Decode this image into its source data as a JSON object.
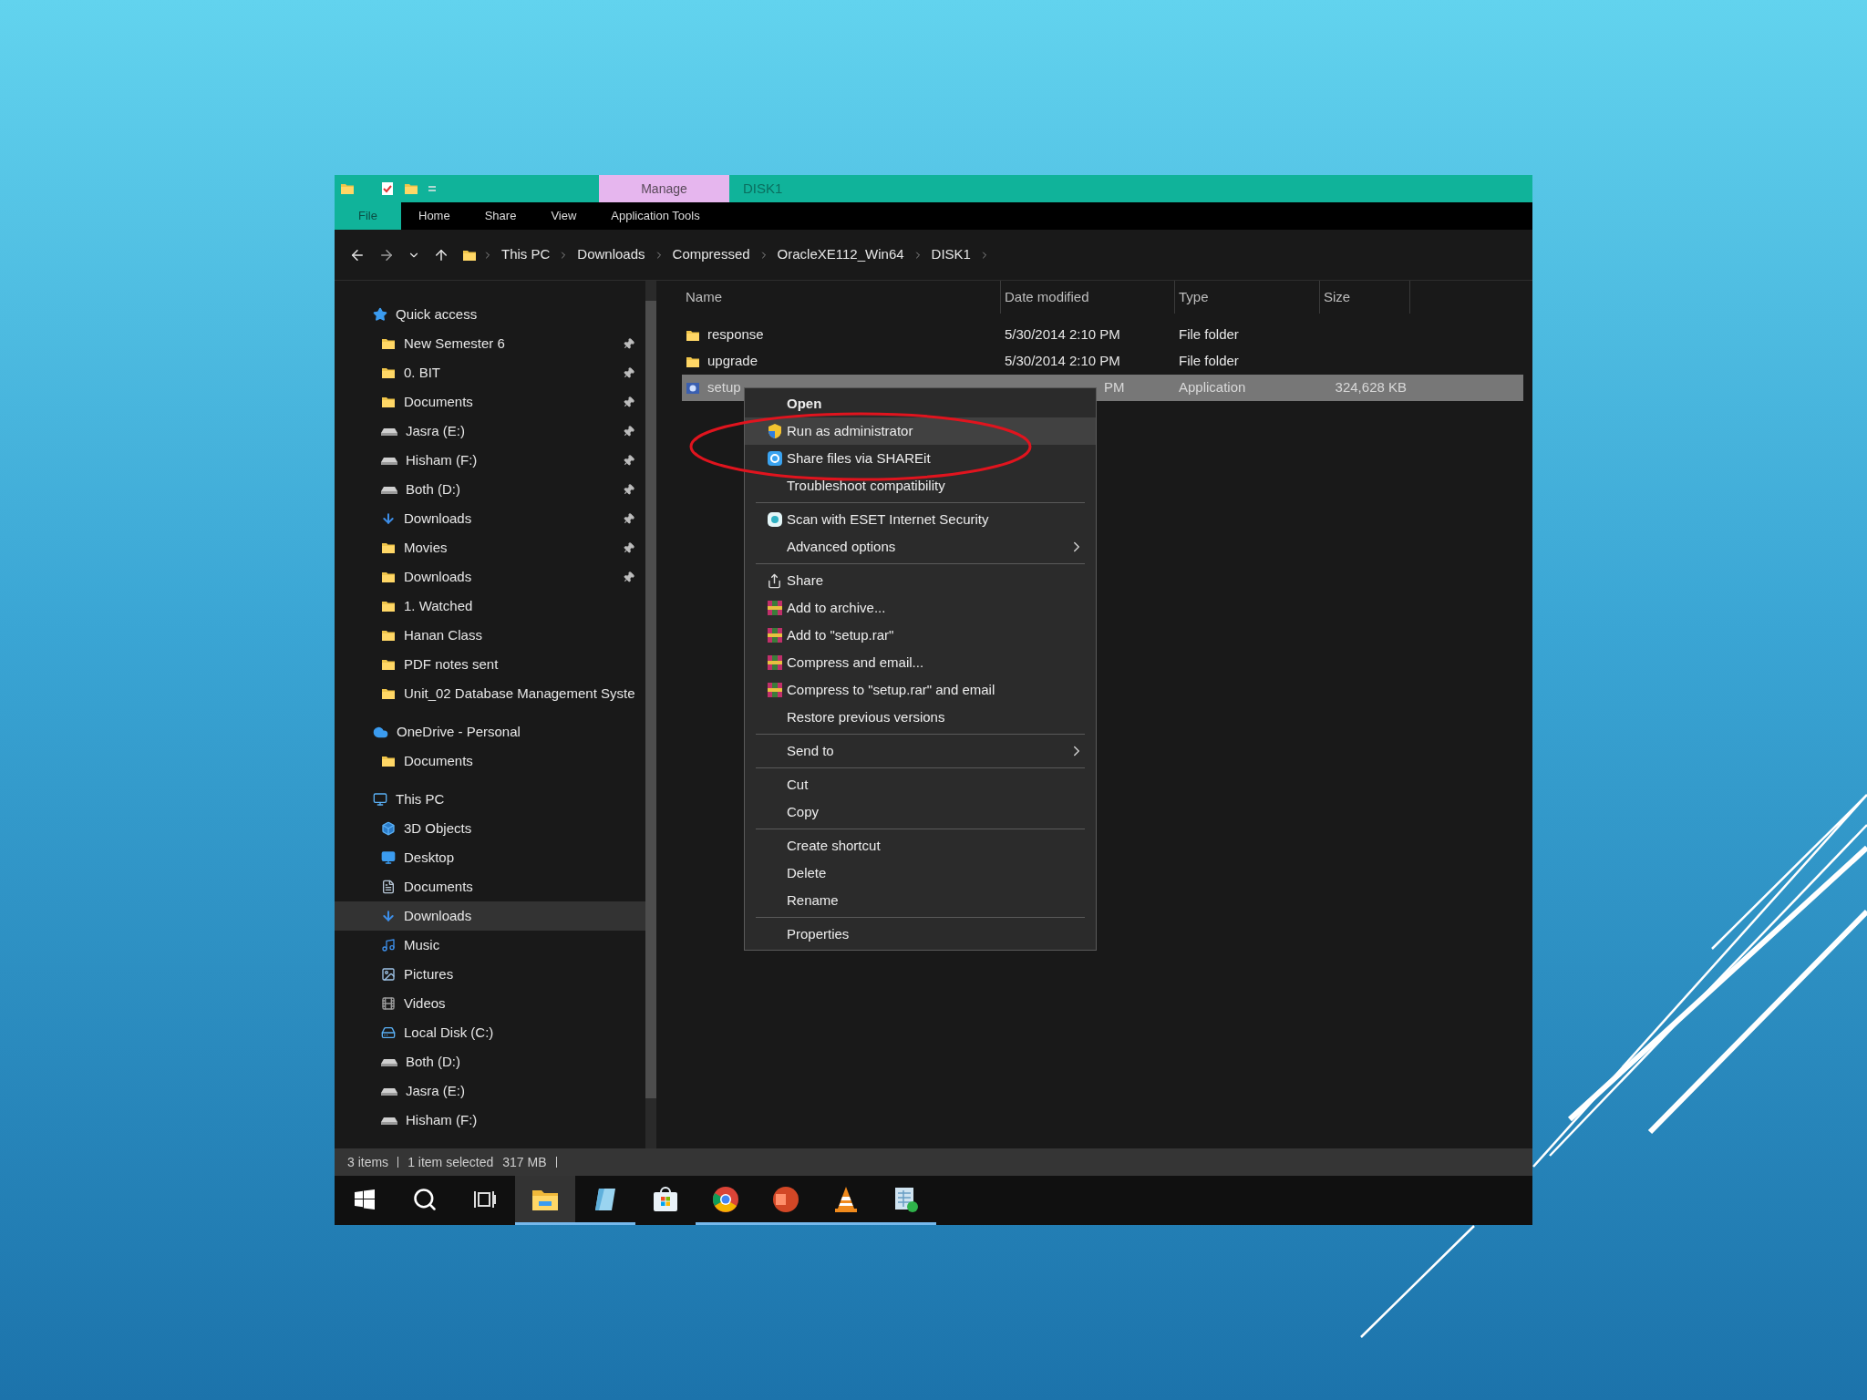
{
  "title_bar": {
    "contextual_tab": "Manage",
    "title": "DISK1"
  },
  "ribbon_tabs": [
    {
      "label": "File",
      "selected": true
    },
    {
      "label": "Home",
      "selected": false
    },
    {
      "label": "Share",
      "selected": false
    },
    {
      "label": "View",
      "selected": false
    },
    {
      "label": "Application Tools",
      "selected": false
    }
  ],
  "address_bar": {
    "breadcrumb": [
      "This PC",
      "Downloads",
      "Compressed",
      "OracleXE112_Win64",
      "DISK1"
    ]
  },
  "navigation_pane": [
    {
      "label": "Quick access",
      "kind": "star",
      "pinned": false,
      "selected": false,
      "children": [
        {
          "label": "New Semester 6",
          "kind": "folder",
          "pinned": true,
          "selected": false
        },
        {
          "label": "0. BIT",
          "kind": "folder",
          "pinned": true,
          "selected": false
        },
        {
          "label": "Documents",
          "kind": "folder",
          "pinned": true,
          "selected": false
        },
        {
          "label": "Jasra (E:)",
          "kind": "drive",
          "pinned": true,
          "selected": false
        },
        {
          "label": "Hisham (F:)",
          "kind": "drive",
          "pinned": true,
          "selected": false
        },
        {
          "label": "Both (D:)",
          "kind": "drive",
          "pinned": true,
          "selected": false
        },
        {
          "label": "Downloads",
          "kind": "download",
          "pinned": true,
          "selected": false
        },
        {
          "label": "Movies",
          "kind": "folder",
          "pinned": true,
          "selected": false
        },
        {
          "label": "Downloads",
          "kind": "folder",
          "pinned": true,
          "selected": false
        },
        {
          "label": "1. Watched",
          "kind": "folder",
          "pinned": false,
          "selected": false
        },
        {
          "label": "Hanan Class",
          "kind": "folder",
          "pinned": false,
          "selected": false
        },
        {
          "label": "PDF notes sent",
          "kind": "folder",
          "pinned": false,
          "selected": false
        },
        {
          "label": "Unit_02 Database Management Syste",
          "kind": "folder",
          "pinned": false,
          "selected": false
        }
      ]
    },
    {
      "label": "OneDrive - Personal",
      "kind": "cloud",
      "pinned": false,
      "selected": false,
      "children": [
        {
          "label": "Documents",
          "kind": "folder",
          "pinned": false,
          "selected": false
        }
      ]
    },
    {
      "label": "This PC",
      "kind": "pc",
      "pinned": false,
      "selected": false,
      "children": [
        {
          "label": "3D Objects",
          "kind": "cube",
          "pinned": false,
          "selected": false
        },
        {
          "label": "Desktop",
          "kind": "desktop",
          "pinned": false,
          "selected": false
        },
        {
          "label": "Documents",
          "kind": "document",
          "pinned": false,
          "selected": false
        },
        {
          "label": "Downloads",
          "kind": "download",
          "pinned": false,
          "selected": true
        },
        {
          "label": "Music",
          "kind": "music",
          "pinned": false,
          "selected": false
        },
        {
          "label": "Pictures",
          "kind": "pictures",
          "pinned": false,
          "selected": false
        },
        {
          "label": "Videos",
          "kind": "videos",
          "pinned": false,
          "selected": false
        },
        {
          "label": "Local Disk (C:)",
          "kind": "system_drive",
          "pinned": false,
          "selected": false
        },
        {
          "label": "Both (D:)",
          "kind": "drive",
          "pinned": false,
          "selected": false
        },
        {
          "label": "Jasra (E:)",
          "kind": "drive",
          "pinned": false,
          "selected": false
        },
        {
          "label": "Hisham (F:)",
          "kind": "drive",
          "pinned": false,
          "selected": false
        }
      ]
    }
  ],
  "file_list": {
    "columns": [
      "Name",
      "Date modified",
      "Type",
      "Size"
    ],
    "rows": [
      {
        "name": "response",
        "kind": "folder",
        "date_modified": "5/30/2014 2:10 PM",
        "type": "File folder",
        "selected": false,
        "partly_hidden": false
      },
      {
        "name": "upgrade",
        "kind": "folder",
        "date_modified": "5/30/2014 2:10 PM",
        "type": "File folder",
        "selected": false,
        "partly_hidden": false
      },
      {
        "name": "setup",
        "kind": "app",
        "date_modified": "PM",
        "type": "Application",
        "size": "324,628 KB",
        "selected": true,
        "partly_hidden": true
      }
    ]
  },
  "context_menu": {
    "sections": [
      {
        "items": [
          {
            "label": "Open",
            "kind": "plain",
            "bold": true,
            "highlighted": false,
            "submenu": false
          },
          {
            "label": "Run as administrator",
            "kind": "shield",
            "bold": false,
            "highlighted": true,
            "submenu": false
          },
          {
            "label": "Share files via SHAREit",
            "kind": "shareit",
            "bold": false,
            "highlighted": false,
            "submenu": false
          },
          {
            "label": "Troubleshoot compatibility",
            "kind": "plain",
            "bold": false,
            "highlighted": false,
            "submenu": false
          }
        ]
      },
      {
        "items": [
          {
            "label": "Scan with ESET Internet Security",
            "kind": "eset",
            "bold": false,
            "highlighted": false,
            "submenu": false
          },
          {
            "label": "Advanced options",
            "kind": "plain",
            "bold": false,
            "highlighted": false,
            "submenu": true
          }
        ]
      },
      {
        "items": [
          {
            "label": "Share",
            "kind": "share",
            "bold": false,
            "highlighted": false,
            "submenu": false
          },
          {
            "label": "Add to archive...",
            "kind": "archive",
            "bold": false,
            "highlighted": false,
            "submenu": false
          },
          {
            "label": "Add to \"setup.rar\"",
            "kind": "archive",
            "bold": false,
            "highlighted": false,
            "submenu": false
          },
          {
            "label": "Compress and email...",
            "kind": "archive",
            "bold": false,
            "highlighted": false,
            "submenu": false
          },
          {
            "label": "Compress to \"setup.rar\" and email",
            "kind": "archive",
            "bold": false,
            "highlighted": false,
            "submenu": false
          },
          {
            "label": "Restore previous versions",
            "kind": "plain",
            "bold": false,
            "highlighted": false,
            "submenu": false
          }
        ]
      },
      {
        "items": [
          {
            "label": "Send to",
            "kind": "plain",
            "bold": false,
            "highlighted": false,
            "submenu": true
          }
        ]
      },
      {
        "items": [
          {
            "label": "Cut",
            "kind": "plain",
            "bold": false,
            "highlighted": false,
            "submenu": false
          },
          {
            "label": "Copy",
            "kind": "plain",
            "bold": false,
            "highlighted": false,
            "submenu": false
          }
        ]
      },
      {
        "items": [
          {
            "label": "Create shortcut",
            "kind": "plain",
            "bold": false,
            "highlighted": false,
            "submenu": false
          },
          {
            "label": "Delete",
            "kind": "plain",
            "bold": false,
            "highlighted": false,
            "submenu": false
          },
          {
            "label": "Rename",
            "kind": "plain",
            "bold": false,
            "highlighted": false,
            "submenu": false
          }
        ]
      },
      {
        "items": [
          {
            "label": "Properties",
            "kind": "plain",
            "bold": false,
            "highlighted": false,
            "submenu": false
          }
        ]
      }
    ]
  },
  "status_bar": {
    "item_count": "3 items",
    "selection": "1 item selected",
    "size": "317 MB"
  },
  "taskbar": [
    {
      "kind": "start",
      "running": false,
      "active": false
    },
    {
      "kind": "search",
      "running": false,
      "active": false
    },
    {
      "kind": "task_view",
      "running": false,
      "active": false
    },
    {
      "kind": "explorer",
      "running": true,
      "active": true
    },
    {
      "kind": "notes",
      "running": true,
      "active": false
    },
    {
      "kind": "store",
      "running": false,
      "active": false
    },
    {
      "kind": "browser",
      "running": true,
      "active": false
    },
    {
      "kind": "slides",
      "running": true,
      "active": false
    },
    {
      "kind": "media_player",
      "running": true,
      "active": false
    },
    {
      "kind": "spreadsheet",
      "running": true,
      "active": false
    }
  ]
}
